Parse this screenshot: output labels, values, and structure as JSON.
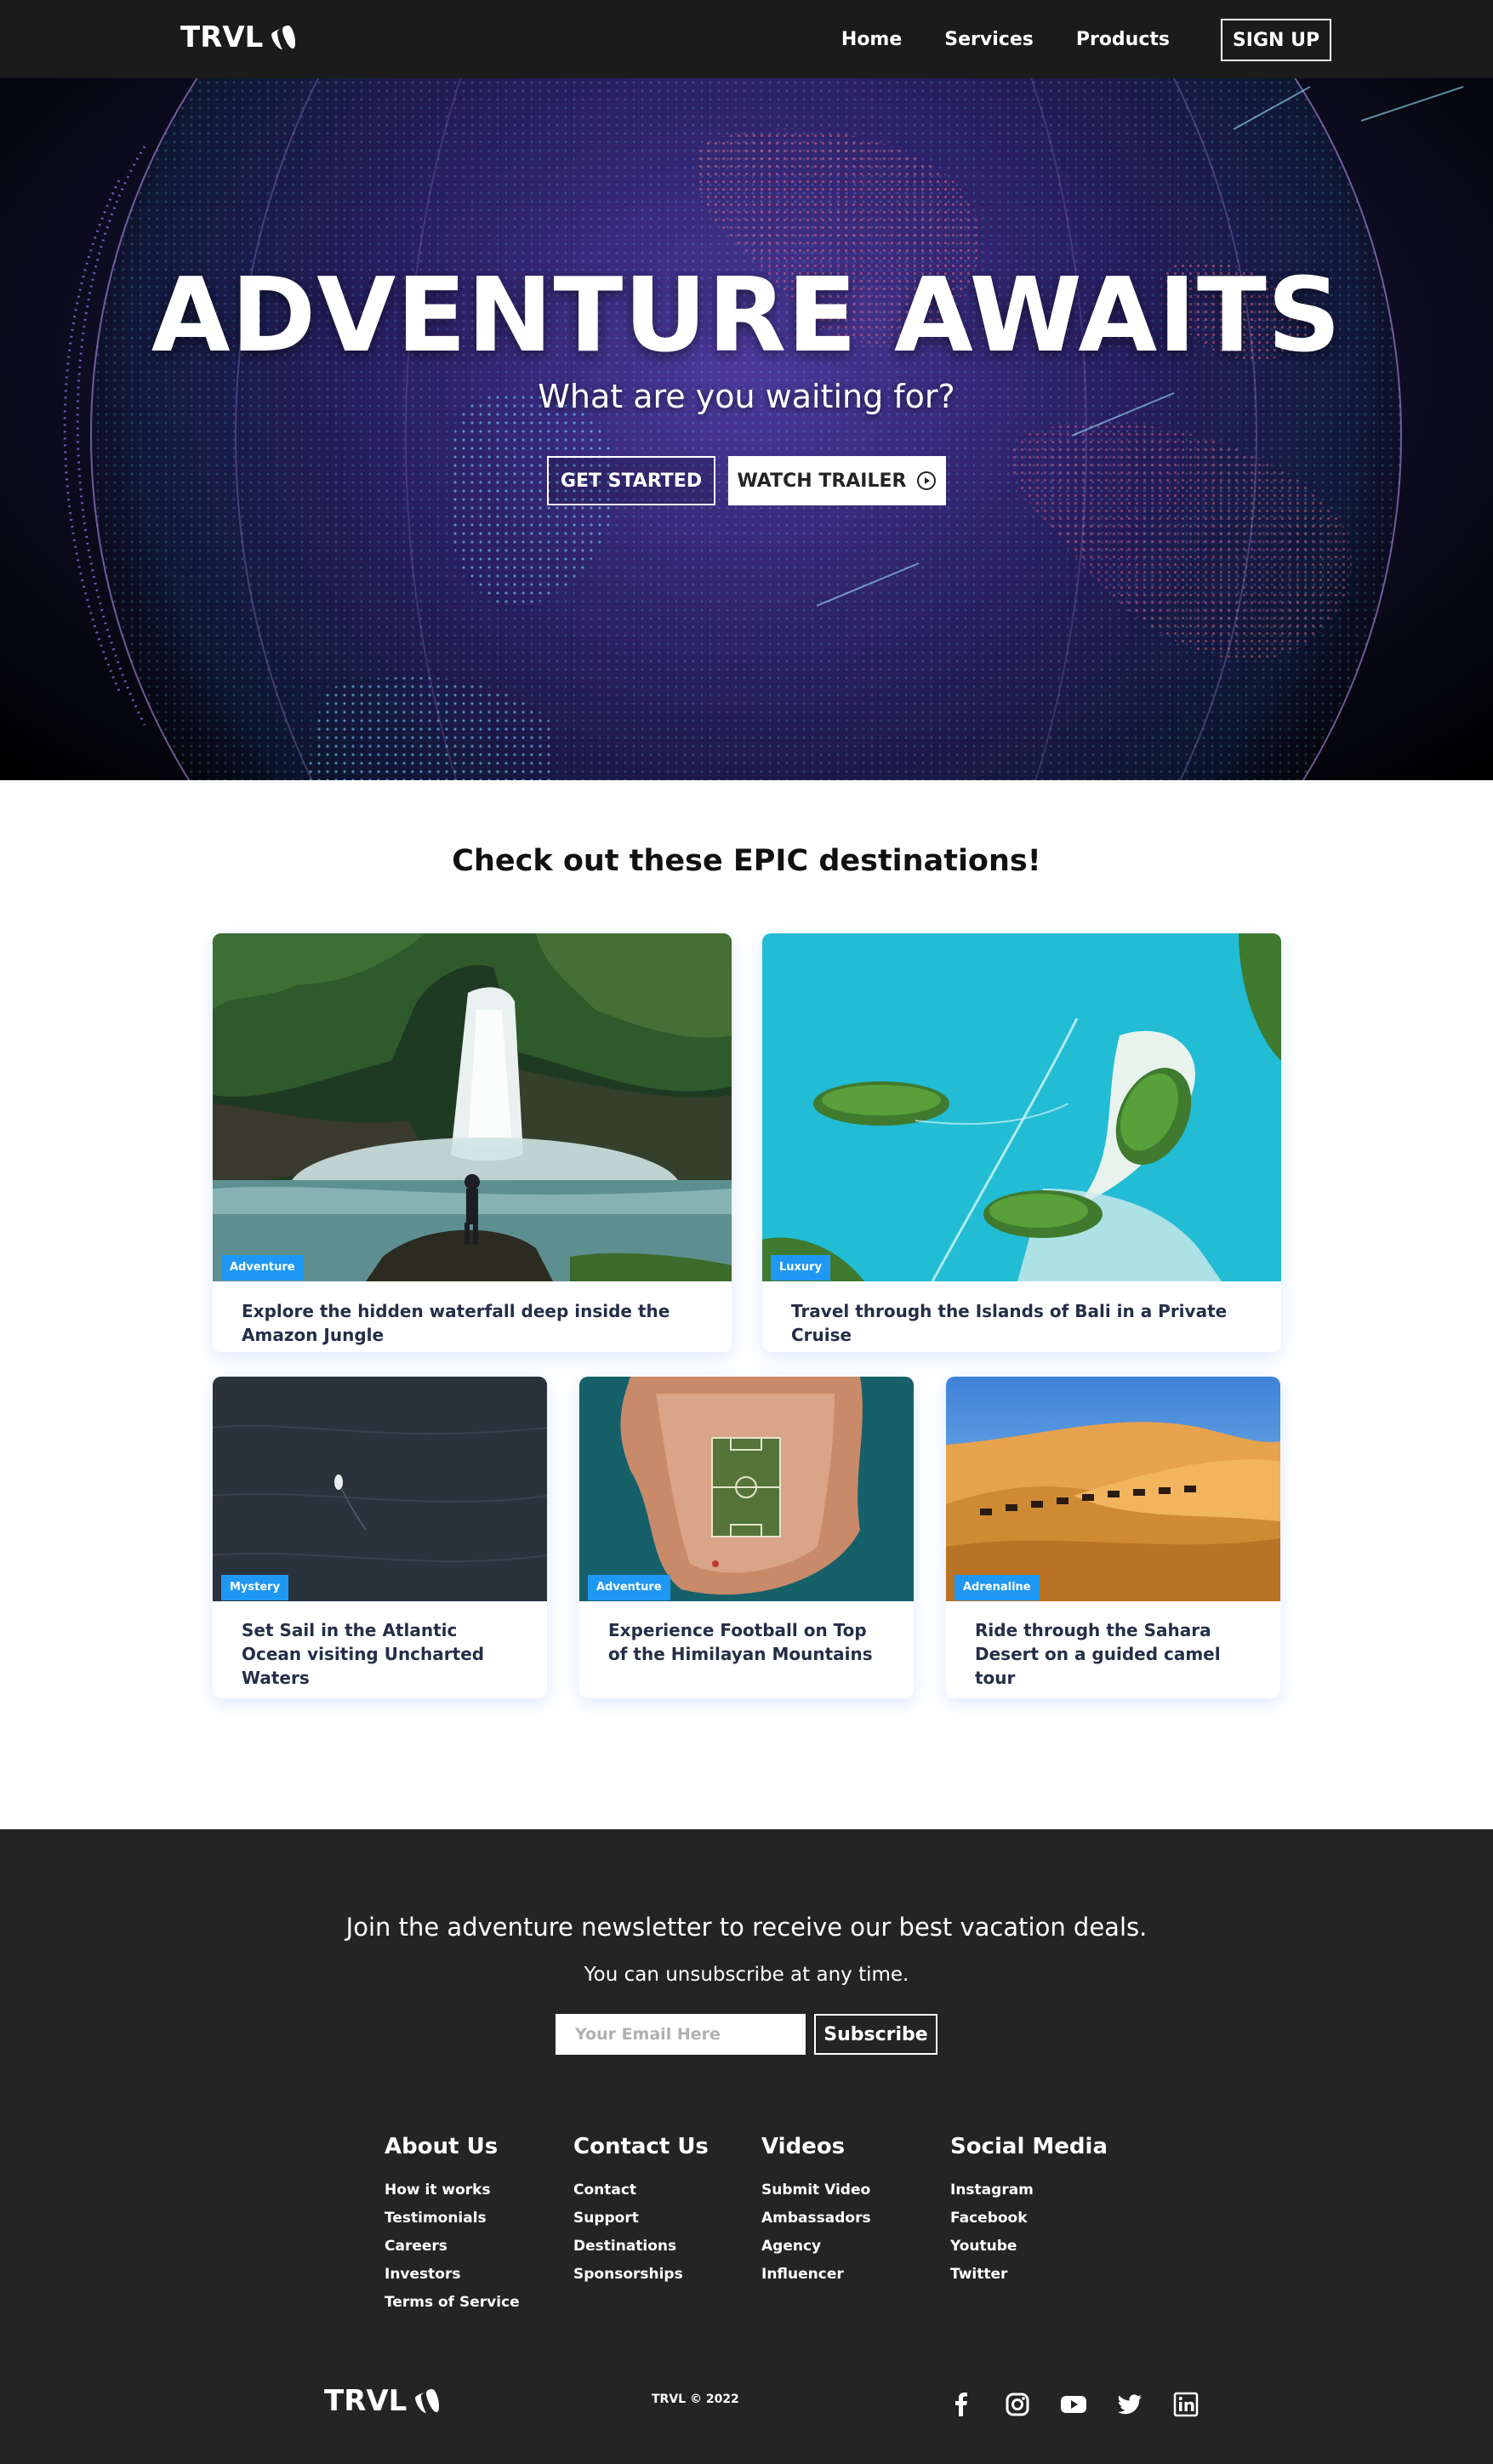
{
  "nav": {
    "logo": "TRVL",
    "links": [
      "Home",
      "Services",
      "Products"
    ],
    "signup": "SIGN UP"
  },
  "hero": {
    "title": "ADVENTURE AWAITS",
    "subtitle": "What are you waiting for?",
    "get_started": "GET STARTED",
    "watch_trailer": "WATCH TRAILER"
  },
  "destinations": {
    "heading": "Check out these EPIC destinations!",
    "cards": [
      {
        "tag": "Adventure",
        "text": "Explore the hidden waterfall deep inside the Amazon Jungle"
      },
      {
        "tag": "Luxury",
        "text": "Travel through the Islands of Bali in a Private Cruise"
      },
      {
        "tag": "Mystery",
        "text": "Set Sail in the Atlantic Ocean visiting Uncharted Waters"
      },
      {
        "tag": "Adventure",
        "text": "Experience Football on Top of the Himilayan Mountains"
      },
      {
        "tag": "Adrenaline",
        "text": "Ride through the Sahara Desert on a guided camel tour"
      }
    ]
  },
  "newsletter": {
    "heading": "Join the adventure newsletter to receive our best vacation deals.",
    "sub": "You can unsubscribe at any time.",
    "placeholder": "Your Email Here",
    "button": "Subscribe"
  },
  "footer": {
    "columns": [
      {
        "title": "About Us",
        "links": [
          "How it works",
          "Testimonials",
          "Careers",
          "Investors",
          "Terms of Service"
        ]
      },
      {
        "title": "Contact Us",
        "links": [
          "Contact",
          "Support",
          "Destinations",
          "Sponsorships"
        ]
      },
      {
        "title": "Videos",
        "links": [
          "Submit Video",
          "Ambassadors",
          "Agency",
          "Influencer"
        ]
      },
      {
        "title": "Social Media",
        "links": [
          "Instagram",
          "Facebook",
          "Youtube",
          "Twitter"
        ]
      }
    ],
    "logo": "TRVL",
    "copyright": "TRVL © 2022",
    "social_icons": [
      "facebook-icon",
      "instagram-icon",
      "youtube-icon",
      "twitter-icon",
      "linkedin-icon"
    ]
  },
  "colors": {
    "nav_bg": "#1b1b1b",
    "footer_bg": "#242424",
    "tag_blue": "#1f98f4"
  }
}
